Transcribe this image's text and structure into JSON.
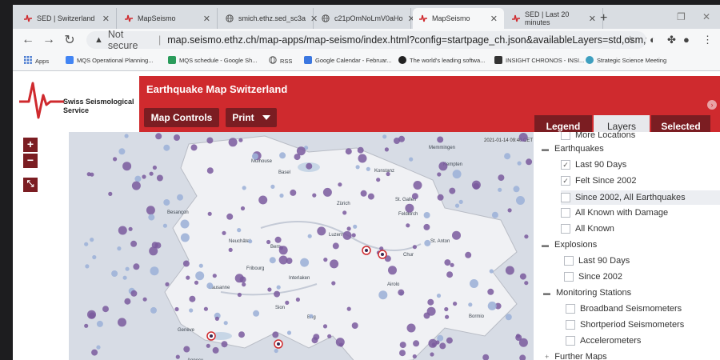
{
  "browser": {
    "tabs": [
      {
        "label": "SED | Switzerland",
        "active": false
      },
      {
        "label": "MapSeismo",
        "active": false
      },
      {
        "label": "smich.ethz.sed_sc3a",
        "active": false
      },
      {
        "label": "c21pOmNoLmV0aHo",
        "active": false
      },
      {
        "label": "MapSeismo",
        "active": true
      },
      {
        "label": "SED | Last 20 minutes",
        "active": false
      }
    ],
    "address": {
      "security_label": "Not secure",
      "url": "map.seismo.ethz.ch/map-apps/map-seismo/index.html?config=startpage_ch.json&availableLayers=std,osm,waterma..."
    },
    "bookmarks": [
      "Apps",
      "MQS Operational Planning...",
      "MQS schedule - Google Sh...",
      "RSS",
      "Google Calendar - Februar...",
      "The world's leading softwa...",
      "INSIGHT CHRONOS - INSI...",
      "Strategic Science Meeting"
    ]
  },
  "app": {
    "brand_line1": "Swiss Seismological",
    "brand_line2": "Service",
    "title": "Earthquake Map Switzerland",
    "map_controls_label": "Map Controls",
    "print_label": "Print",
    "legend_tabs": [
      "Legend",
      "Layers",
      "Selected"
    ],
    "timestamp": "2021-01-14 09:40 CET",
    "brand_color": "#cf2a2e",
    "dark_color": "#7b1d22"
  },
  "map": {
    "places": [
      "Memmingen",
      "Mulhouse",
      "Kempten",
      "Konstanz",
      "Basel",
      "St. Gallen",
      "Zürich",
      "Feldkirch",
      "Besançon",
      "Luzern",
      "St. Anton",
      "Neuchâtel",
      "Bern",
      "Chur",
      "Fribourg",
      "Interlaken",
      "Lausanne",
      "Airolo",
      "Sion",
      "Brig",
      "Genève",
      "Bormio",
      "Annecy"
    ]
  },
  "layers": {
    "more_locations": "More Locations",
    "earthquakes": {
      "title": "Earthquakes",
      "items": [
        {
          "label": "Last 90 Days",
          "checked": true
        },
        {
          "label": "Felt Since 2002",
          "checked": true
        },
        {
          "label": "Since 2002, All Earthquakes",
          "checked": false
        },
        {
          "label": "All Known with Damage",
          "checked": false
        },
        {
          "label": "All Known",
          "checked": false
        }
      ]
    },
    "explosions": {
      "title": "Explosions",
      "items": [
        {
          "label": "Last 90 Days",
          "checked": false
        },
        {
          "label": "Since 2002",
          "checked": false
        }
      ]
    },
    "stations": {
      "title": "Monitoring Stations",
      "items": [
        {
          "label": "Broadband Seismometers",
          "checked": false
        },
        {
          "label": "Shortperiod Seismometers",
          "checked": false
        },
        {
          "label": "Accelerometers",
          "checked": false
        }
      ]
    },
    "further_maps": "Further Maps"
  }
}
